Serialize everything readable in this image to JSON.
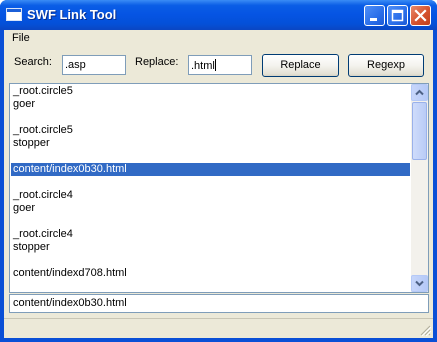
{
  "window": {
    "title": "SWF Link Tool",
    "controls": {
      "minimize": "minimize-icon",
      "maximize": "maximize-icon",
      "close": "close-icon"
    }
  },
  "menu": {
    "file": "File"
  },
  "toolbar": {
    "search_label": "Search:",
    "search_value": ".asp",
    "replace_label": "Replace:",
    "replace_value": ".html",
    "replace_button": "Replace",
    "regexp_button": "Regexp"
  },
  "list": {
    "selected_index": 6,
    "lines": [
      "_root.circle5",
      "goer",
      "",
      "_root.circle5",
      "stopper",
      "",
      "content/index0b30.html",
      "",
      "_root.circle4",
      "goer",
      "",
      "_root.circle4",
      "stopper",
      "",
      "content/indexd708.html"
    ]
  },
  "selection_field": {
    "value": "content/index0b30.html"
  },
  "colors": {
    "selection": "#316ac5",
    "titlebar": "#0554e3",
    "client": "#ece9d8",
    "close_button": "#d5522e"
  }
}
